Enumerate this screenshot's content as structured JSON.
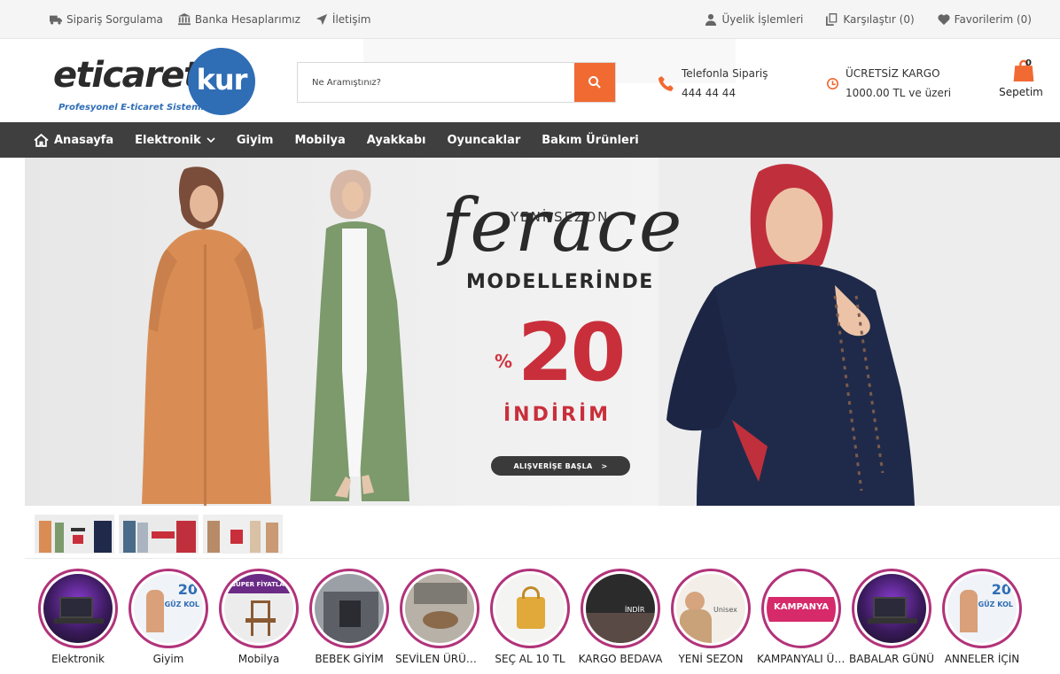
{
  "topbar": {
    "left": [
      {
        "label": "Sipariş Sorgulama",
        "icon": "truck-icon"
      },
      {
        "label": "Banka Hesaplarımız",
        "icon": "bank-icon"
      },
      {
        "label": "İletişim",
        "icon": "location-arrow-icon"
      }
    ],
    "right": [
      {
        "label": "Üyelik İşlemleri",
        "icon": "user-icon"
      },
      {
        "label": "Karşılaştır (0)",
        "icon": "copy-icon"
      },
      {
        "label": "Favorilerim (0)",
        "icon": "heart-icon"
      }
    ]
  },
  "header": {
    "logo_word": "eticaret",
    "logo_circle": "kur",
    "logo_sub": "Profesyonel E-ticaret Sistemi",
    "search_placeholder": "Ne Aramıştınız?",
    "phone_label": "Telefonla Sipariş",
    "phone_number": "444 44 44",
    "cargo_label": "ÜCRETSİZ KARGO",
    "cargo_sub": "1000.00 TL ve üzeri",
    "cart_count": "0",
    "cart_label": "Sepetim"
  },
  "nav": [
    {
      "label": "Anasayfa",
      "icon": "home-icon"
    },
    {
      "label": "Elektronik",
      "dropdown": true
    },
    {
      "label": "Giyim"
    },
    {
      "label": "Mobilya"
    },
    {
      "label": "Ayakkabı"
    },
    {
      "label": "Oyuncaklar"
    },
    {
      "label": "Bakım Ürünleri"
    }
  ],
  "banner": {
    "tag1": "YENİ SEZON",
    "script": "ferace",
    "tag2": "MODELLERİNDE",
    "pct_sign": "%",
    "amount": "20",
    "tag3": "İNDİRİM",
    "cta": "ALIŞVERİŞE BAŞLA",
    "cta_arrow": ">"
  },
  "colors": {
    "accent": "#f16a32",
    "nav_bg": "#3f3f3f",
    "logo_blue": "#2f6db5",
    "ring": "#b1337a",
    "sale_red": "#c92f3b"
  },
  "categories": [
    {
      "label": "Elektronik"
    },
    {
      "label": "Giyim"
    },
    {
      "label": "Mobilya"
    },
    {
      "label": "BEBEK GİYİM"
    },
    {
      "label": "SEVİLEN ÜRÜNLER"
    },
    {
      "label": "SEÇ AL 10 TL"
    },
    {
      "label": "KARGO BEDAVA"
    },
    {
      "label": "YENİ SEZON"
    },
    {
      "label": "KAMPANYALI ÜRÜNLER"
    },
    {
      "label": "BABALAR GÜNÜ"
    },
    {
      "label": "ANNELER İÇİN"
    }
  ],
  "circle_art": {
    "giyim_badge": "20",
    "giyim_text": "GÜZ KOL",
    "mobilya_banner": "SÜPER FİYATLAR",
    "kampanya": "KAMPANYA",
    "yeni_sezon": "Unisex",
    "kargo_text": "İNDİR",
    "anneler_badge": "20",
    "anneler_text": "GÜZ KOL"
  }
}
